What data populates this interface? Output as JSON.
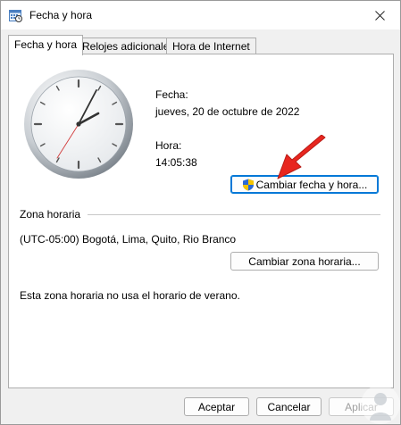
{
  "window": {
    "title": "Fecha y hora",
    "close_glyph": "✕"
  },
  "tabs": [
    {
      "label": "Fecha y hora",
      "active": true
    },
    {
      "label": "Relojes adicionales",
      "active": false
    },
    {
      "label": "Hora de Internet",
      "active": false
    }
  ],
  "date_time": {
    "date_label": "Fecha:",
    "date_value": "jueves, 20 de octubre de 2022",
    "time_label": "Hora:",
    "time_value": "14:05:38",
    "change_button": "Cambiar fecha y hora..."
  },
  "timezone": {
    "section_title": "Zona horaria",
    "value": "(UTC-05:00) Bogotá, Lima, Quito, Rio Branco",
    "change_button": "Cambiar zona horaria...",
    "dst_note": "Esta zona horaria no usa el horario de verano."
  },
  "footer": {
    "ok_label": "Aceptar",
    "cancel_label": "Cancelar",
    "apply_label": "Aplicar"
  },
  "colors": {
    "arrow": "#e8261f",
    "focus": "#0078d7"
  }
}
